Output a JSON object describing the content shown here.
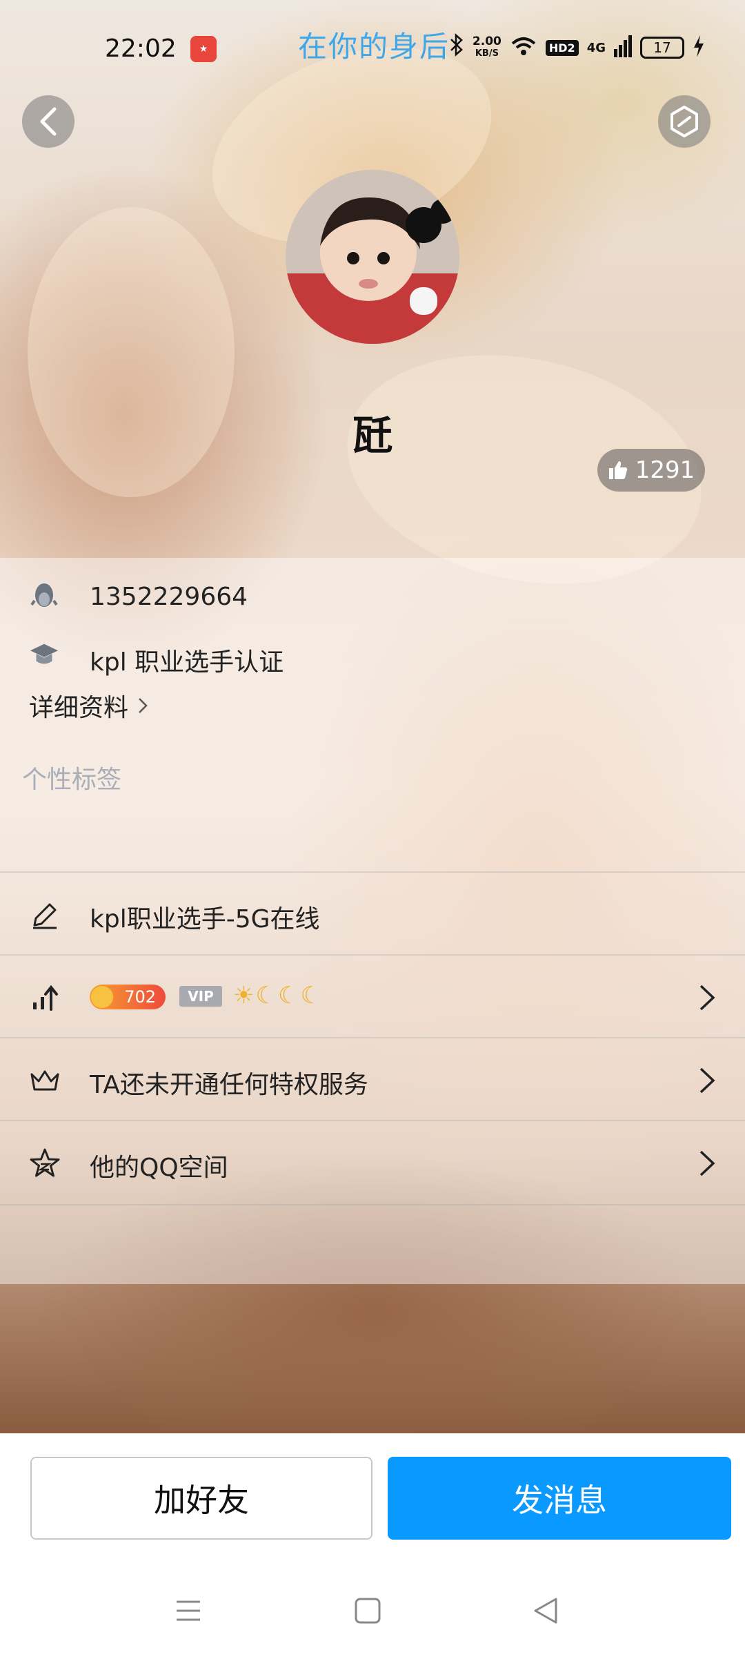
{
  "status_bar": {
    "time": "22:02",
    "marquee": "在你的身后",
    "speed_value": "2.00",
    "speed_unit": "KB/S",
    "hd_label": "HD2",
    "network_label": "4G",
    "battery": "17",
    "icons": [
      "app-badge-icon",
      "bluetooth-icon",
      "wifi-icon",
      "signal-icon",
      "charging-icon"
    ]
  },
  "profile": {
    "nickname": "瓩",
    "likes": "1291",
    "qq_number": "1352229664",
    "certification": "kpl 职业选手认证",
    "detail_link": "详细资料",
    "tags_placeholder": "个性标签"
  },
  "list": {
    "signature": "kpl职业选手-5G在线",
    "level": "702",
    "vip_label": "VIP",
    "privilege": "TA还未开通任何特权服务",
    "qzone": "他的QQ空间"
  },
  "actions": {
    "add_friend": "加好友",
    "send_message": "发消息"
  },
  "colors": {
    "accent": "#0a99ff",
    "marquee": "#3da7ea",
    "placeholder": "#a9aeb8"
  }
}
